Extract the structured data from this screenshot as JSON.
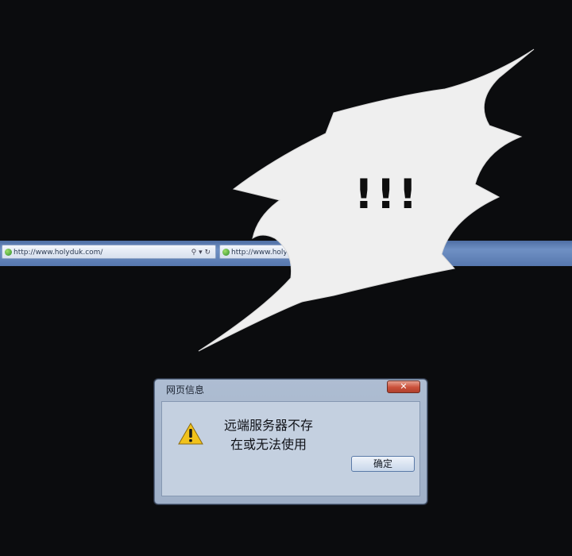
{
  "browser": {
    "url_left": "http://www.holyduk.com/",
    "url_right": "http://www.holyduk.com/",
    "controls": "⚲ ▾ ↻"
  },
  "burst": {
    "text": "!!!"
  },
  "dialog": {
    "title": "网页信息",
    "close_label": "✕",
    "message_line1": "远端服务器不存",
    "message_line2": "在或无法使用",
    "ok_label": "确定",
    "icon": "warning-icon"
  },
  "colors": {
    "background": "#0b0c0e",
    "address_bar": "#5677ad",
    "dialog": "#aebdd2",
    "close_button": "#c9503a",
    "warning": "#f1c21b"
  }
}
